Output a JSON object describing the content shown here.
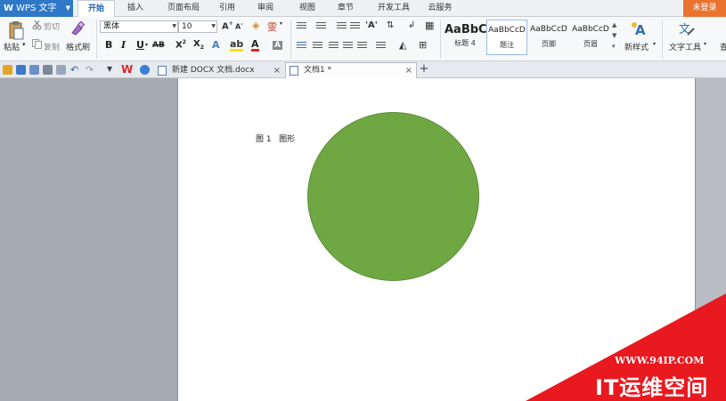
{
  "app": {
    "logo_text": "WPS 文字",
    "login_label": "未登录"
  },
  "menu_tabs": [
    "开始",
    "插入",
    "页面布局",
    "引用",
    "审阅",
    "视图",
    "章节",
    "开发工具",
    "云服务"
  ],
  "ribbon": {
    "paste": "粘贴",
    "cut": "剪切",
    "copy": "复制",
    "format_painter": "格式刷",
    "font_name": "黑体",
    "font_size": "10",
    "styles": [
      {
        "sample": "AaBbC",
        "label": "标题 4"
      },
      {
        "sample": "AaBbCcD",
        "label": "题注"
      },
      {
        "sample": "AaBbCcD",
        "label": "页脚"
      },
      {
        "sample": "AaBbCcD",
        "label": "页眉"
      }
    ],
    "new_style": "新样式",
    "text_tools": "文字工具",
    "find_partial": "查"
  },
  "doc_tabs": [
    {
      "label": "新建 DOCX 文档.docx",
      "close": "×"
    },
    {
      "label": "文档1 *",
      "close": "×"
    }
  ],
  "add_tab": "+",
  "document": {
    "caption": "图 1   图形",
    "shape_color": "#6fa843"
  },
  "watermark": {
    "url": "WWW.94IP.COM",
    "name": "IT运维空间"
  }
}
